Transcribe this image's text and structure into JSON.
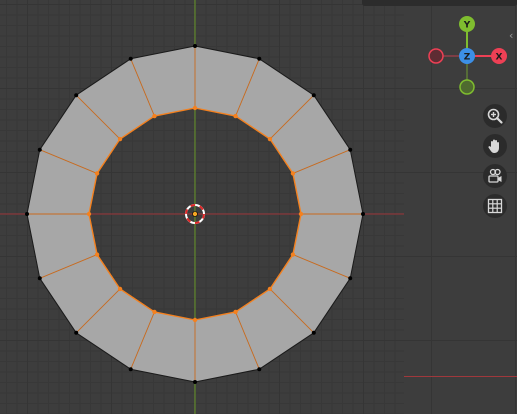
{
  "colors": {
    "background": "#3d3d3d",
    "grid_minor": "#383838",
    "grid_major": "#353535",
    "x_axis": "#a0383c",
    "y_axis": "#6b9a2c",
    "face": "#a7a7a7",
    "selected_edge": "#f4811f",
    "outer_edge": "#1a1a1a",
    "vertex": "#000000",
    "gizmo_x": "#ee4055",
    "gizmo_y": "#7fbd2f",
    "gizmo_z": "#3c8fe6"
  },
  "mesh": {
    "type": "ring",
    "segments": 16,
    "inner_edges_selected": true,
    "outer_edges_selected": false
  },
  "gizmo": {
    "x_label": "X",
    "y_label": "Y",
    "z_label": "Z"
  },
  "nav_buttons": [
    {
      "name": "zoom-button",
      "icon": "zoom-plus-icon"
    },
    {
      "name": "pan-button",
      "icon": "hand-icon"
    },
    {
      "name": "camera-view-button",
      "icon": "camera-icon"
    },
    {
      "name": "ortho-toggle-button",
      "icon": "grid-icon"
    }
  ],
  "sidebar": {
    "collapse_glyph": "‹"
  }
}
